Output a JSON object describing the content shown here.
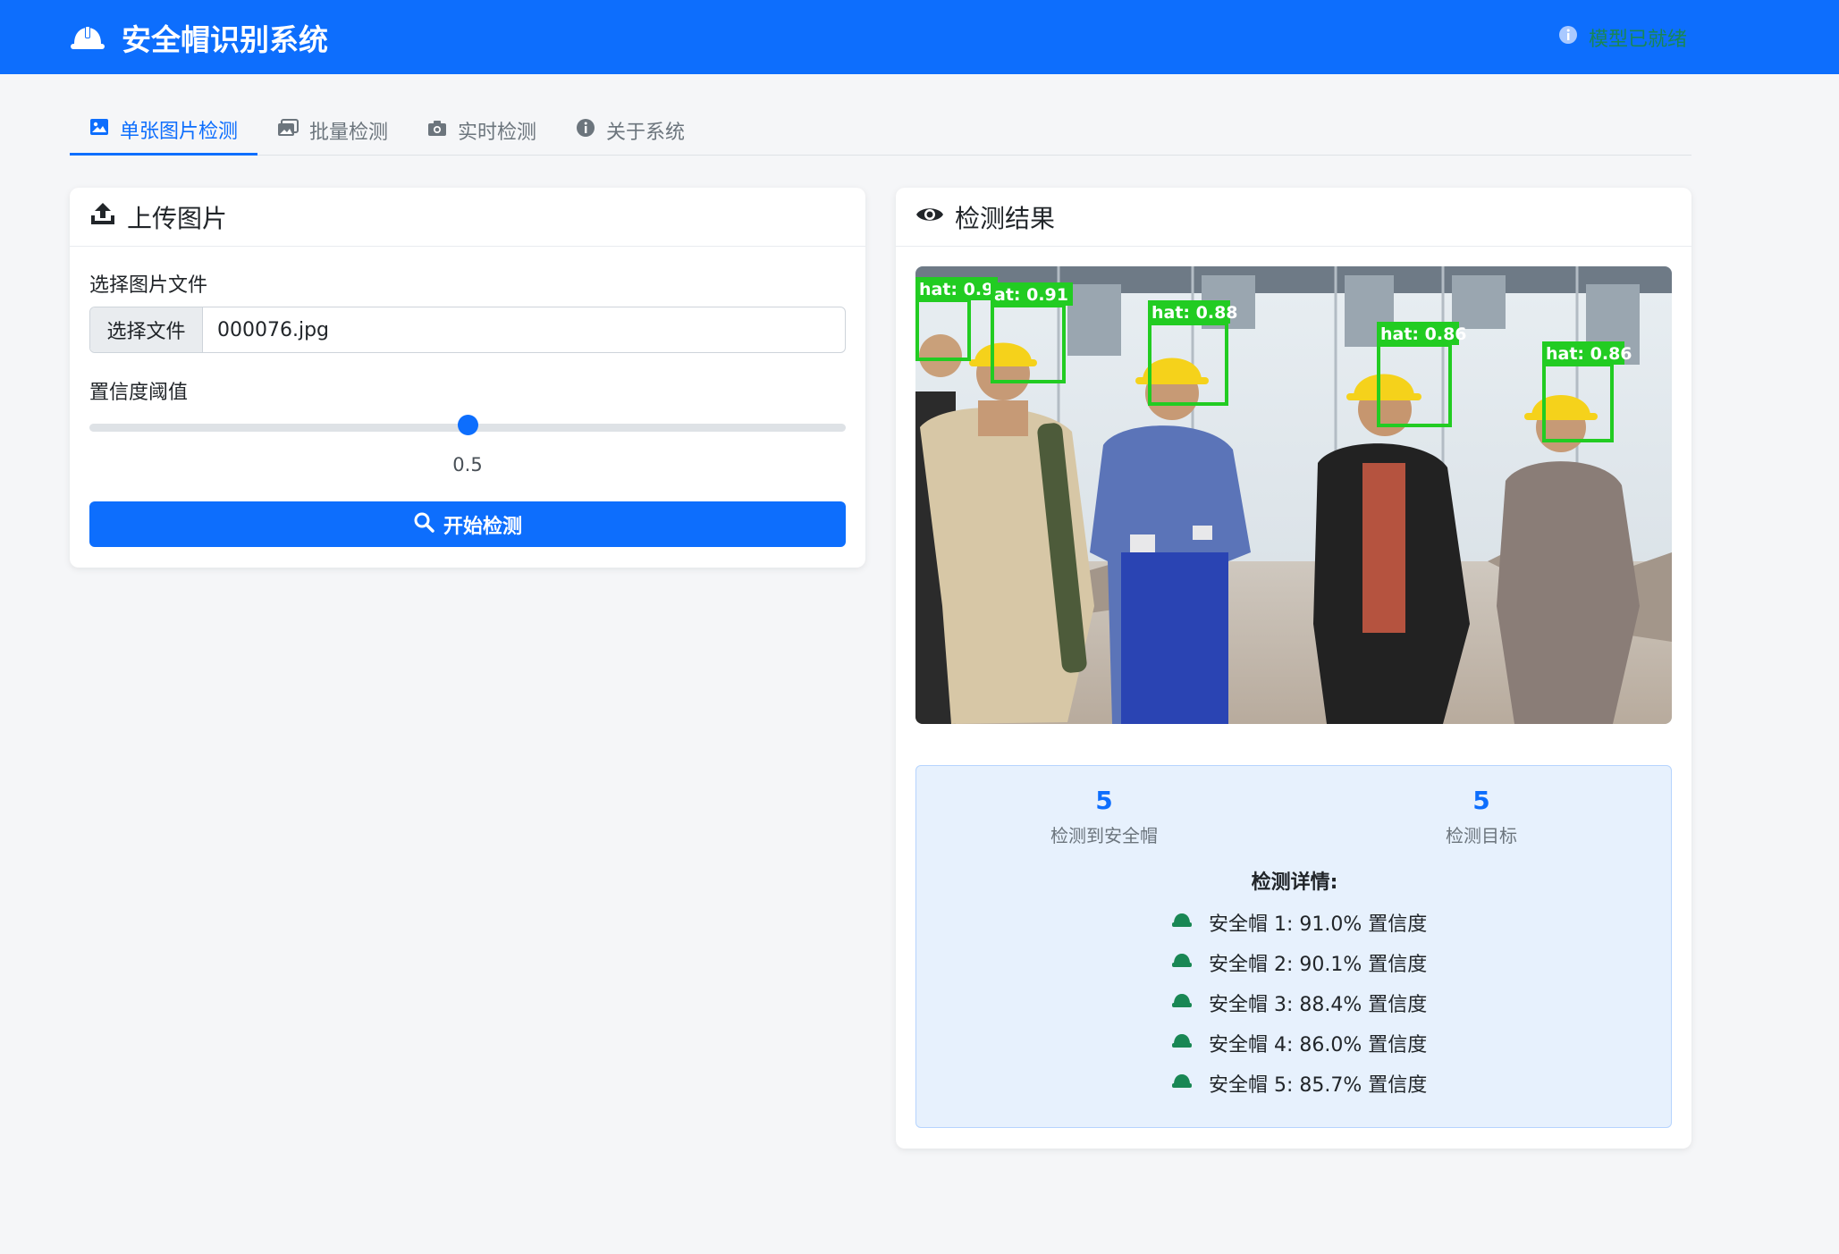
{
  "header": {
    "title": "安全帽识别系统",
    "status": "模型已就绪"
  },
  "tabs": [
    {
      "label": "单张图片检测",
      "active": true
    },
    {
      "label": "批量检测",
      "active": false
    },
    {
      "label": "实时检测",
      "active": false
    },
    {
      "label": "关于系统",
      "active": false
    }
  ],
  "upload": {
    "title": "上传图片",
    "file_label": "选择图片文件",
    "file_button": "选择文件",
    "file_name": "000076.jpg",
    "confidence_label": "置信度阈值",
    "confidence_value": "0.5",
    "confidence_fraction": 0.5,
    "detect_button": "开始检测"
  },
  "result": {
    "title": "检测结果",
    "detections": [
      {
        "label": "hat: 0.90"
      },
      {
        "label": "at: 0.91"
      },
      {
        "label": "hat: 0.88"
      },
      {
        "label": "hat: 0.86"
      },
      {
        "label": "hat: 0.86"
      }
    ],
    "stats": {
      "helmets_count": "5",
      "helmets_label": "检测到安全帽",
      "targets_count": "5",
      "targets_label": "检测目标"
    },
    "details_title": "检测详情:",
    "details": [
      "安全帽 1: 91.0% 置信度",
      "安全帽 2: 90.1% 置信度",
      "安全帽 3: 88.4% 置信度",
      "安全帽 4: 86.0% 置信度",
      "安全帽 5: 85.7% 置信度"
    ]
  },
  "colors": {
    "primary": "#0d6efd",
    "success": "#198754",
    "detection_box": "#22cc22"
  }
}
